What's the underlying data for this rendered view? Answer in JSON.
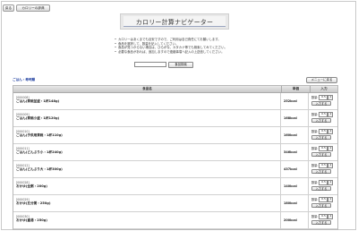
{
  "nav": {
    "back_label": "戻る",
    "top_label": "カロリーの辞典"
  },
  "header": {
    "title": "カロリー計算ナビゲーター"
  },
  "notes": [
    "カロリーはあくまでも目安ですので、ご利用は自己責任にてお願いします。",
    "食品を選択して、数量を記入してください。",
    "食品が見つからない場合は、ひらがな、カタカナ等でも検索してみてください。",
    "必要な食品があれば、追加しますので連絡事項へ記入の上送信してください。"
  ],
  "search": {
    "value": "",
    "button_label": "食品検索"
  },
  "category": {
    "label": "ごはん・寿司類"
  },
  "menu_button_label": "メニューに戻る",
  "table": {
    "headers": {
      "name": "食品名",
      "calorie": "単価",
      "input": "入力"
    },
    "qty_label": "数量:",
    "qty_value": "0.5",
    "qty_select": "▾",
    "add_label": "入力する",
    "rows": [
      {
        "code": "[000008]",
        "name": "ごはん(茶碗並盛・1杯148g)",
        "calorie": "252kcal"
      },
      {
        "code": "[000009]",
        "name": "ごはん(茶碗小盛・1杯120g)",
        "calorie": "168kcal"
      },
      {
        "code": "[000010]",
        "name": "ごはん(子供用茶碗・1杯110g)",
        "calorie": "160kcal"
      },
      {
        "code": "[000011]",
        "name": "ごはん(どんぶり小・1杯240g)",
        "calorie": "346kcal"
      },
      {
        "code": "[000012]",
        "name": "ごはん(どんぶり大・1杯300g)",
        "calorie": "437kcal"
      },
      {
        "code": "[000028]",
        "name": "おかゆ(全粥・200g)",
        "calorie": "140kcal"
      },
      {
        "code": "[000029]",
        "name": "おかゆ(五分粥・250g)",
        "calorie": "180kcal"
      },
      {
        "code": "[000030]",
        "name": "おかゆ(重湯・250g)",
        "calorie": "200kcal"
      }
    ]
  }
}
